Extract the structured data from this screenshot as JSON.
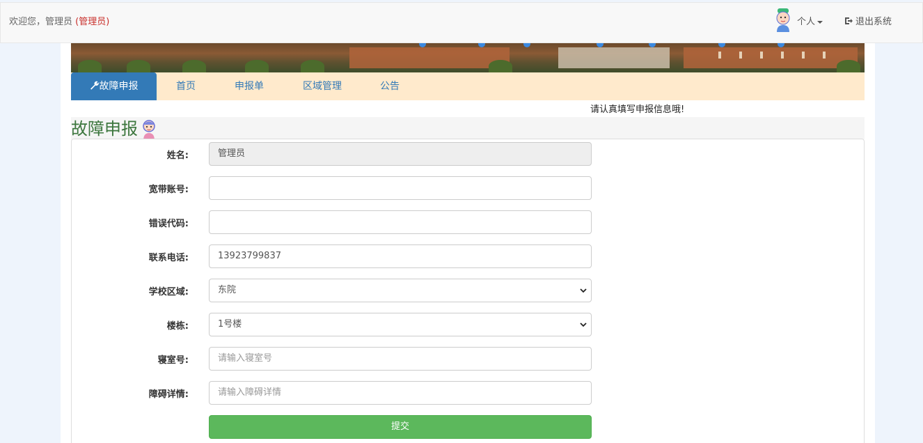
{
  "header": {
    "welcome_prefix": "欢迎您，管理员",
    "welcome_role": "(管理员)",
    "personal_label": "个人",
    "logout_label": "退出系统"
  },
  "nav": {
    "tabs": [
      {
        "label": "故障申报",
        "active": true
      },
      {
        "label": "首页"
      },
      {
        "label": "申报单"
      },
      {
        "label": "区域管理"
      },
      {
        "label": "公告"
      }
    ]
  },
  "notice": "请认真填写申报信息哦!",
  "page_title": "故障申报",
  "form": {
    "fields": [
      {
        "label": "姓名:",
        "value": "管理员",
        "placeholder": ""
      },
      {
        "label": "宽带账号:",
        "value": "",
        "placeholder": ""
      },
      {
        "label": "错误代码:",
        "value": "",
        "placeholder": ""
      },
      {
        "label": "联系电话:",
        "value": "13923799837",
        "placeholder": ""
      },
      {
        "label": "学校区域:",
        "value": "东院",
        "placeholder": ""
      },
      {
        "label": "楼栋:",
        "value": "1号楼",
        "placeholder": ""
      },
      {
        "label": "寝室号:",
        "value": "",
        "placeholder": "请输入寝室号"
      },
      {
        "label": "障碍详情:",
        "value": "",
        "placeholder": "请输入障碍详情"
      }
    ],
    "submit_label": "提交"
  },
  "colors": {
    "primary": "#337ab7",
    "success": "#5cb85c",
    "title_green": "#3c763d",
    "role_red": "#c9302c",
    "tabs_bg": "#ffeacc"
  }
}
